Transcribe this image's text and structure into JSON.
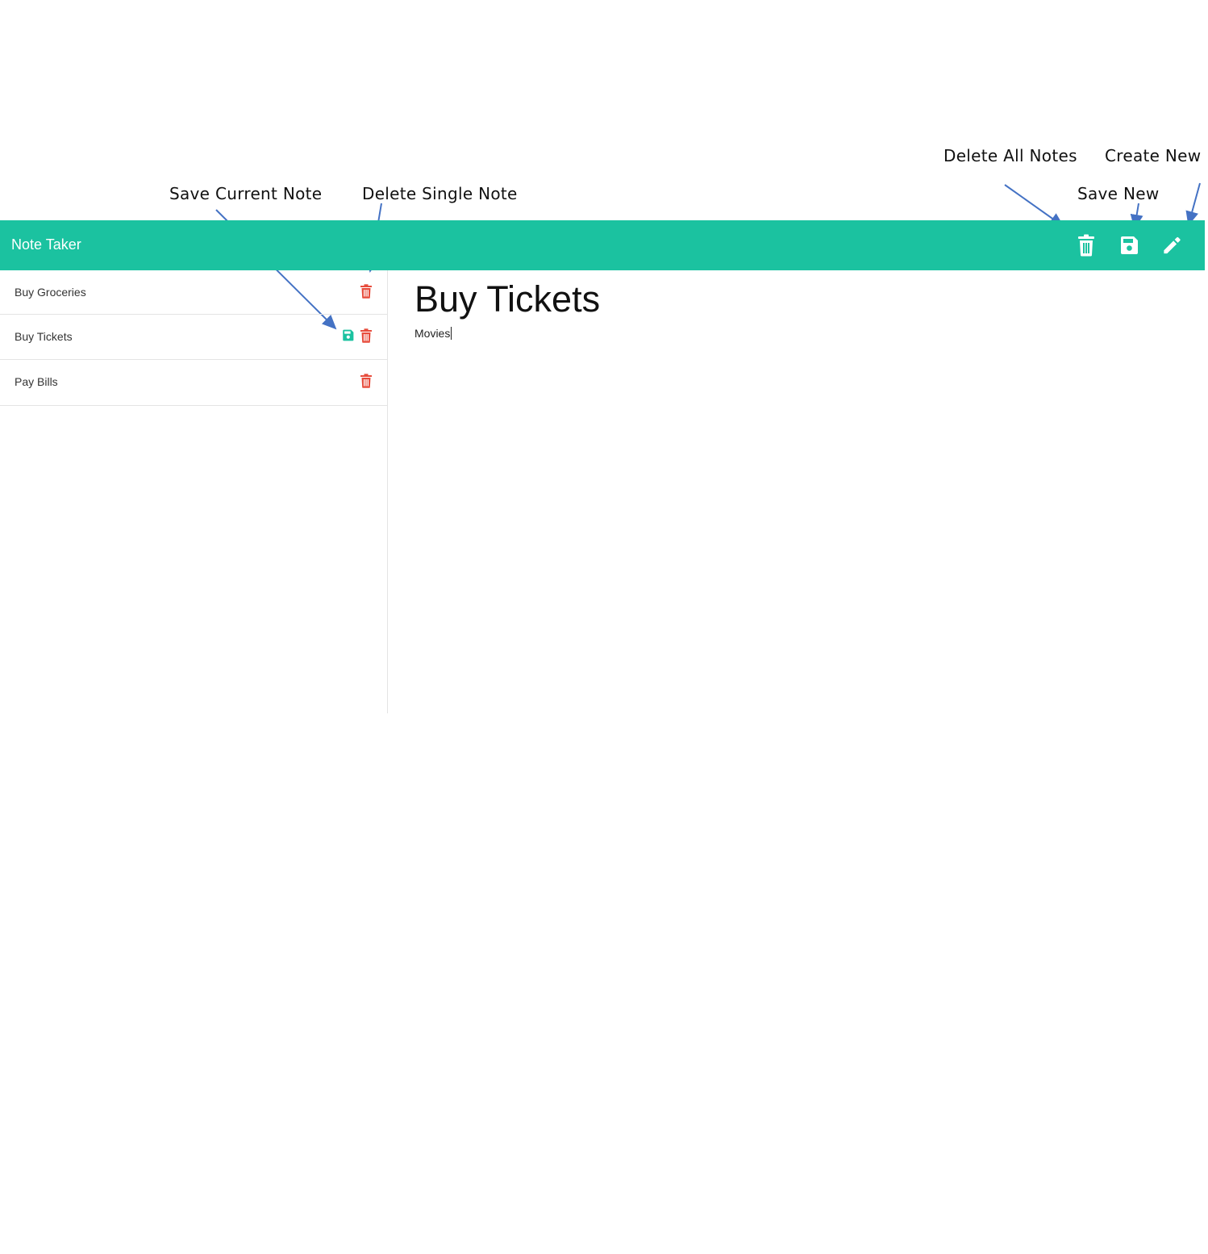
{
  "annotations": {
    "save_current_note": "Save Current Note",
    "delete_single_note": "Delete Single Note",
    "delete_all_notes": "Delete All Notes",
    "create_new": "Create New",
    "save_new": "Save New"
  },
  "navbar": {
    "brand": "Note Taker",
    "icons": [
      "trash-icon",
      "save-icon",
      "pencil-icon"
    ]
  },
  "notes": [
    {
      "title": "Buy Groceries",
      "unsaved": false
    },
    {
      "title": "Buy Tickets",
      "unsaved": true
    },
    {
      "title": "Pay Bills",
      "unsaved": false
    }
  ],
  "editor": {
    "title": "Buy Tickets",
    "body": "Movies"
  },
  "colors": {
    "accent": "#1bc2a0",
    "danger": "#e74c3c",
    "arrow": "#4472c4"
  }
}
